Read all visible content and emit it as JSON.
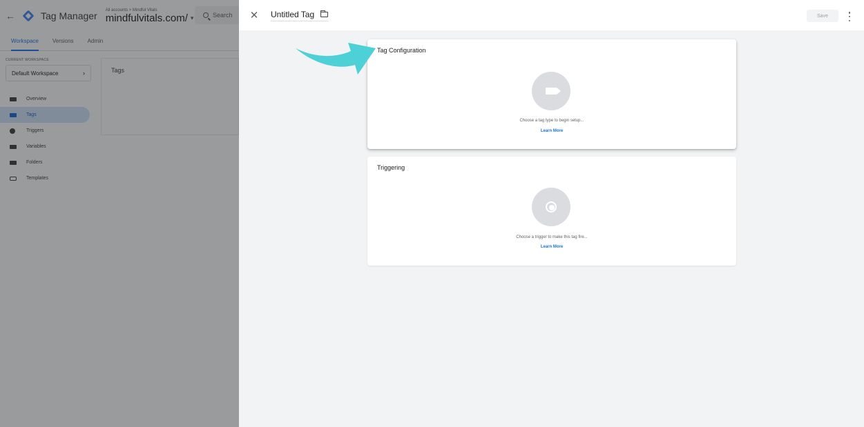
{
  "background_app": {
    "app_name": "Tag Manager",
    "account_breadcrumb": "All accounts > Mindful Vitals",
    "container_name": "mindfulvitals.com/",
    "search_placeholder": "Search",
    "tabs": [
      {
        "label": "Workspace",
        "active": true
      },
      {
        "label": "Versions",
        "active": false
      },
      {
        "label": "Admin",
        "active": false
      }
    ],
    "workspace_label": "CURRENT WORKSPACE",
    "workspace_name": "Default Workspace",
    "nav_items": [
      {
        "label": "Overview",
        "icon": "overview-icon",
        "active": false
      },
      {
        "label": "Tags",
        "icon": "tag-icon",
        "active": true
      },
      {
        "label": "Triggers",
        "icon": "trigger-icon",
        "active": false
      },
      {
        "label": "Variables",
        "icon": "variables-icon",
        "active": false
      },
      {
        "label": "Folders",
        "icon": "folder-icon",
        "active": false
      },
      {
        "label": "Templates",
        "icon": "templates-icon",
        "active": false
      }
    ],
    "tags_card_title": "Tags"
  },
  "editor": {
    "title": "Untitled Tag",
    "save_label": "Save",
    "config_card": {
      "title": "Tag Configuration",
      "hint": "Choose a tag type to begin setup...",
      "link": "Learn More"
    },
    "trigger_card": {
      "title": "Triggering",
      "hint": "Choose a trigger to make this tag fire...",
      "link": "Learn More"
    }
  },
  "colors": {
    "accent": "#1a73e8",
    "pointer_arrow": "#4dd0d6",
    "panel_bg": "#f1f3f4",
    "badge_grey": "#dadce0"
  }
}
